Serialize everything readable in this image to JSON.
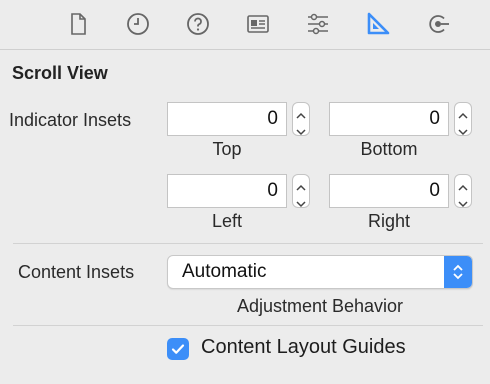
{
  "toolbar": {
    "icons": [
      "file-icon",
      "history-icon",
      "help-icon",
      "identity-icon",
      "attributes-icon",
      "size-icon",
      "connections-icon"
    ],
    "active": "size-icon",
    "accent": "#3c8ef8"
  },
  "section": {
    "title": "Scroll View"
  },
  "indicator_insets": {
    "label": "Indicator Insets",
    "top": {
      "value": "0",
      "label": "Top"
    },
    "bottom": {
      "value": "0",
      "label": "Bottom"
    },
    "left": {
      "value": "0",
      "label": "Left"
    },
    "right": {
      "value": "0",
      "label": "Right"
    }
  },
  "content_insets": {
    "label": "Content Insets",
    "value": "Automatic",
    "caption": "Adjustment Behavior"
  },
  "content_layout_guides": {
    "label": "Content Layout Guides",
    "checked": true
  }
}
